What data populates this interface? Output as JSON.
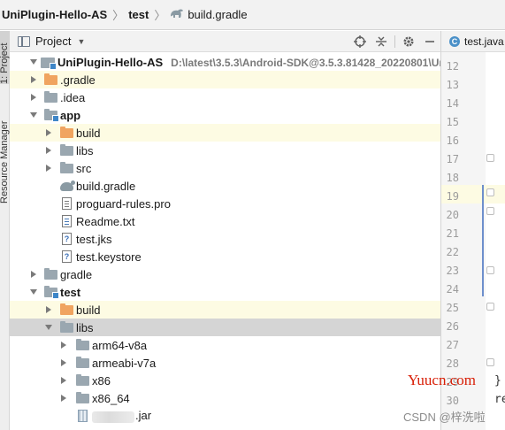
{
  "breadcrumb": {
    "items": [
      "UniPlugin-Hello-AS",
      "test",
      "build.gradle"
    ],
    "separator": "〉"
  },
  "side_tool_tabs": {
    "project": "1: Project",
    "resource_manager": "Resource Manager"
  },
  "project_panel": {
    "view_label": "Project",
    "actions": [
      "crosshair-icon",
      "collapse-icon",
      "gear-icon",
      "minimize-icon"
    ]
  },
  "tree": [
    {
      "name": "UniPlugin-Hello-AS",
      "path": "D:\\latest\\3.5.3\\Android-SDK@3.5.3.81428_20220801\\UniPl",
      "icon": "project-folder-icon",
      "expanded": true,
      "bold": true
    },
    {
      "name": ".gradle",
      "icon": "folder-orange-icon",
      "expanded": false
    },
    {
      "name": ".idea",
      "icon": "folder-icon",
      "expanded": false
    },
    {
      "name": "app",
      "icon": "module-folder-icon",
      "expanded": true,
      "bold": true
    },
    {
      "name": "build",
      "icon": "folder-orange-icon",
      "expanded": false
    },
    {
      "name": "libs",
      "icon": "folder-icon",
      "expanded": false
    },
    {
      "name": "src",
      "icon": "folder-icon",
      "expanded": false
    },
    {
      "name": "build.gradle",
      "icon": "gradle-icon"
    },
    {
      "name": "proguard-rules.pro",
      "icon": "pro-file-icon"
    },
    {
      "name": "Readme.txt",
      "icon": "text-file-icon"
    },
    {
      "name": "test.jks",
      "icon": "unknown-file-icon"
    },
    {
      "name": "test.keystore",
      "icon": "unknown-file-icon"
    },
    {
      "name": "gradle",
      "icon": "folder-icon",
      "expanded": false
    },
    {
      "name": "test",
      "icon": "module-folder-icon",
      "expanded": true,
      "bold": true
    },
    {
      "name": "build",
      "icon": "folder-orange-icon",
      "expanded": false
    },
    {
      "name": "libs",
      "icon": "folder-icon",
      "expanded": true,
      "selected": true
    },
    {
      "name": "arm64-v8a",
      "icon": "folder-icon",
      "expanded": false
    },
    {
      "name": "armeabi-v7a",
      "icon": "folder-icon",
      "expanded": false
    },
    {
      "name": "x86",
      "icon": "folder-icon",
      "expanded": false
    },
    {
      "name": "x86_64",
      "icon": "folder-icon",
      "expanded": false
    },
    {
      "name": ".jar",
      "icon": "jar-icon",
      "name_obscured": true
    }
  ],
  "editor": {
    "tab_label": "test.java",
    "tab_icon": "C",
    "line_numbers": [
      "12",
      "13",
      "14",
      "15",
      "16",
      "17",
      "18",
      "19",
      "20",
      "21",
      "22",
      "23",
      "24",
      "25",
      "26",
      "27",
      "28",
      "29",
      "30"
    ],
    "current_line": "19",
    "code_fragments": {
      "line_29": "}",
      "line_30": "re"
    }
  },
  "watermarks": {
    "site": "Yuucn.com",
    "csdn": "CSDN @梓洗啦"
  },
  "colors": {
    "highlight_row": "#fdfbe3",
    "selected_row": "#d5d5d5",
    "folder_orange": "#f0a460",
    "folder_gray": "#9aa7b0",
    "watermark_red": "#d81e06"
  }
}
